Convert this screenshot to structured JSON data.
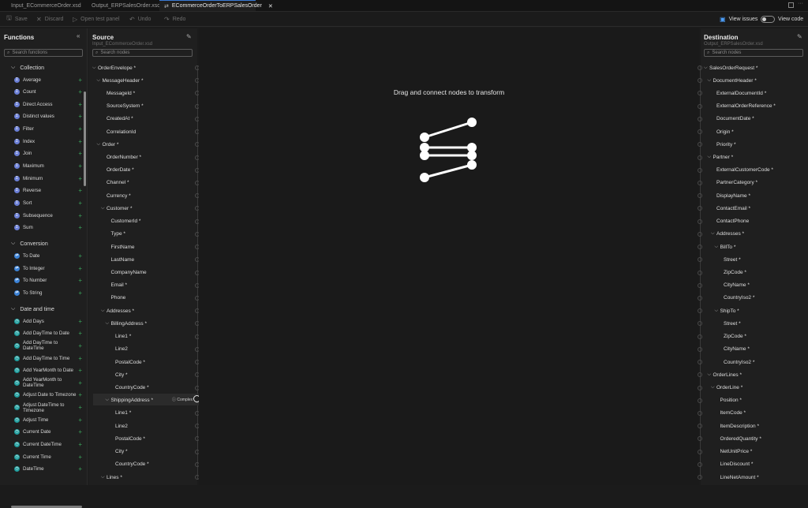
{
  "tabs": [
    {
      "label": "Input_ECommerceOrder.xsd",
      "icon": "xsd-file-icon",
      "active": false
    },
    {
      "label": "Output_ERPSalesOrder.xsd",
      "icon": "xsd-file-icon",
      "active": false
    },
    {
      "label": "ECommerceOrderToERPSalesOrder",
      "icon": "map-icon",
      "active": true
    }
  ],
  "toolbar": {
    "save": "Save",
    "discard": "Discard",
    "open_test_panel": "Open test panel",
    "undo": "Undo",
    "redo": "Redo",
    "view_issues": "View issues",
    "view_code": "View code"
  },
  "functions": {
    "title": "Functions",
    "search_placeholder": "Search functions",
    "groups": [
      {
        "name": "Collection",
        "color": "#6b7fd6",
        "items": [
          "Average",
          "Count",
          "Direct Access",
          "Distinct values",
          "Filter",
          "Index",
          "Join",
          "Maximum",
          "Minimum",
          "Reverse",
          "Sort",
          "Subsequence",
          "Sum"
        ]
      },
      {
        "name": "Conversion",
        "color": "#3b82d6",
        "items": [
          "To Date",
          "To Integer",
          "To Number",
          "To String"
        ]
      },
      {
        "name": "Date and time",
        "color": "#1f9e9e",
        "items": [
          "Add Days",
          "Add DayTime to Date",
          "Add DayTime to DateTime",
          "Add DayTime to Time",
          "Add YearMonth to Date",
          "Add YearMonth to DateTime",
          "Adjust Date to Timezone",
          "Adjust DateTime to Timezone",
          "Adjust Time",
          "Current Date",
          "Current DateTime",
          "Current Time",
          "DateTime"
        ]
      }
    ]
  },
  "source": {
    "title": "Source",
    "subtitle": "Input_ECommerceOrder.xsd",
    "search_placeholder": "Search nodes",
    "complex_label": "Complex",
    "nodes": [
      {
        "label": "OrderEnvelope *",
        "level": 0,
        "chev": true
      },
      {
        "label": "MessageHeader *",
        "level": 1,
        "chev": true
      },
      {
        "label": "MessageId *",
        "level": 2,
        "chev": false
      },
      {
        "label": "SourceSystem *",
        "level": 2,
        "chev": false
      },
      {
        "label": "CreatedAt *",
        "level": 2,
        "chev": false
      },
      {
        "label": "CorrelationId",
        "level": 2,
        "chev": false
      },
      {
        "label": "Order *",
        "level": 1,
        "chev": true
      },
      {
        "label": "OrderNumber *",
        "level": 2,
        "chev": false
      },
      {
        "label": "OrderDate *",
        "level": 2,
        "chev": false
      },
      {
        "label": "Channel *",
        "level": 2,
        "chev": false
      },
      {
        "label": "Currency *",
        "level": 2,
        "chev": false
      },
      {
        "label": "Customer *",
        "level": 2,
        "chev": true
      },
      {
        "label": "CustomerId *",
        "level": 3,
        "chev": false
      },
      {
        "label": "Type *",
        "level": 3,
        "chev": false
      },
      {
        "label": "FirstName",
        "level": 3,
        "chev": false
      },
      {
        "label": "LastName",
        "level": 3,
        "chev": false
      },
      {
        "label": "CompanyName",
        "level": 3,
        "chev": false
      },
      {
        "label": "Email *",
        "level": 3,
        "chev": false
      },
      {
        "label": "Phone",
        "level": 3,
        "chev": false
      },
      {
        "label": "Addresses *",
        "level": 2,
        "chev": true
      },
      {
        "label": "BillingAddress *",
        "level": 3,
        "chev": true
      },
      {
        "label": "Line1 *",
        "level": 4,
        "chev": false
      },
      {
        "label": "Line2",
        "level": 4,
        "chev": false
      },
      {
        "label": "PostalCode *",
        "level": 4,
        "chev": false
      },
      {
        "label": "City *",
        "level": 4,
        "chev": false
      },
      {
        "label": "CountryCode *",
        "level": 4,
        "chev": false
      },
      {
        "label": "ShippingAddress *",
        "level": 3,
        "chev": true
      },
      {
        "label": "Line1 *",
        "level": 4,
        "chev": false
      },
      {
        "label": "Line2",
        "level": 4,
        "chev": false
      },
      {
        "label": "PostalCode *",
        "level": 4,
        "chev": false
      },
      {
        "label": "City *",
        "level": 4,
        "chev": false
      },
      {
        "label": "CountryCode *",
        "level": 4,
        "chev": false
      },
      {
        "label": "Lines *",
        "level": 2,
        "chev": true
      }
    ]
  },
  "canvas": {
    "hint": "Drag and connect nodes to transform"
  },
  "destination": {
    "title": "Destination",
    "subtitle": "Output_ERPSalesOrder.xsd",
    "search_placeholder": "Search nodes",
    "nodes": [
      {
        "label": "SalesOrderRequest *",
        "level": 0,
        "chev": true
      },
      {
        "label": "DocumentHeader *",
        "level": 1,
        "chev": true
      },
      {
        "label": "ExternalDocumentId *",
        "level": 2,
        "chev": false
      },
      {
        "label": "ExternalOrderReference *",
        "level": 2,
        "chev": false
      },
      {
        "label": "DocumentDate *",
        "level": 2,
        "chev": false
      },
      {
        "label": "Origin *",
        "level": 2,
        "chev": false
      },
      {
        "label": "Priority *",
        "level": 2,
        "chev": false
      },
      {
        "label": "Partner *",
        "level": 1,
        "chev": true
      },
      {
        "label": "ExternalCustomerCode *",
        "level": 2,
        "chev": false
      },
      {
        "label": "PartnerCategory *",
        "level": 2,
        "chev": false
      },
      {
        "label": "DisplayName *",
        "level": 2,
        "chev": false
      },
      {
        "label": "ContactEmail *",
        "level": 2,
        "chev": false
      },
      {
        "label": "ContactPhone",
        "level": 2,
        "chev": false
      },
      {
        "label": "Addresses *",
        "level": 2,
        "chev": true
      },
      {
        "label": "BillTo *",
        "level": 3,
        "chev": true
      },
      {
        "label": "Street *",
        "level": 4,
        "chev": false
      },
      {
        "label": "ZipCode *",
        "level": 4,
        "chev": false
      },
      {
        "label": "CityName *",
        "level": 4,
        "chev": false
      },
      {
        "label": "CountryIso2 *",
        "level": 4,
        "chev": false
      },
      {
        "label": "ShipTo *",
        "level": 3,
        "chev": true
      },
      {
        "label": "Street *",
        "level": 4,
        "chev": false
      },
      {
        "label": "ZipCode *",
        "level": 4,
        "chev": false
      },
      {
        "label": "CityName *",
        "level": 4,
        "chev": false
      },
      {
        "label": "CountryIso2 *",
        "level": 4,
        "chev": false
      },
      {
        "label": "OrderLines *",
        "level": 1,
        "chev": true
      },
      {
        "label": "OrderLine *",
        "level": 2,
        "chev": true
      },
      {
        "label": "Position *",
        "level": 3,
        "chev": false
      },
      {
        "label": "ItemCode *",
        "level": 3,
        "chev": false
      },
      {
        "label": "ItemDescription *",
        "level": 3,
        "chev": false
      },
      {
        "label": "OrderedQuantity *",
        "level": 3,
        "chev": false
      },
      {
        "label": "NetUnitPrice *",
        "level": 3,
        "chev": false
      },
      {
        "label": "LineDiscount *",
        "level": 3,
        "chev": false
      },
      {
        "label": "LineNetAmount *",
        "level": 3,
        "chev": false
      }
    ]
  }
}
